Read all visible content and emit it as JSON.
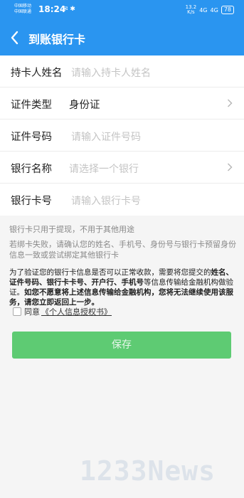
{
  "status_bar": {
    "carrier_1": "中国移动",
    "carrier_2": "中国联通",
    "time": "18:24",
    "icons_left": "✉ ✱",
    "net_speed_value": "13.2",
    "net_speed_unit": "K/s",
    "signal_1": "4G",
    "signal_2": "4G",
    "battery": "78"
  },
  "nav": {
    "title": "到账银行卡"
  },
  "form": {
    "cardholder": {
      "label": "持卡人姓名",
      "placeholder": "请输入持卡人姓名"
    },
    "id_type": {
      "label": "证件类型",
      "value": "身份证"
    },
    "id_number": {
      "label": "证件号码",
      "placeholder": "请输入证件号码"
    },
    "bank_name": {
      "label": "银行名称",
      "placeholder": "请选择一个银行"
    },
    "card_number": {
      "label": "银行卡号",
      "placeholder": "请输入银行卡号"
    }
  },
  "hints": {
    "usage": "银行卡只用于提现，不用于其他用途",
    "failure": "若绑卡失败，请确认您的姓名、手机号、身份号与银行卡预留身份信息一致或尝试绑定其他银行卡"
  },
  "notice": {
    "part1": "为了验证您的银行卡信息是否可以正常收款，需要将您提交的",
    "bold1": "姓名、证件号码、银行卡卡号、开户行、手机号",
    "part2": "等信息传输给金融机构做验证。",
    "bold2": "如您不愿意将上述信息传输给金融机构，您将无法继续使用该服务，请您立即返回上一步。"
  },
  "agreement": {
    "prefix": "同意",
    "link": "《个人信息授权书》"
  },
  "save_button": "保存",
  "watermark": "1233News",
  "colors": {
    "brand_blue": "#2a95f0",
    "save_green": "#5ecb73"
  }
}
